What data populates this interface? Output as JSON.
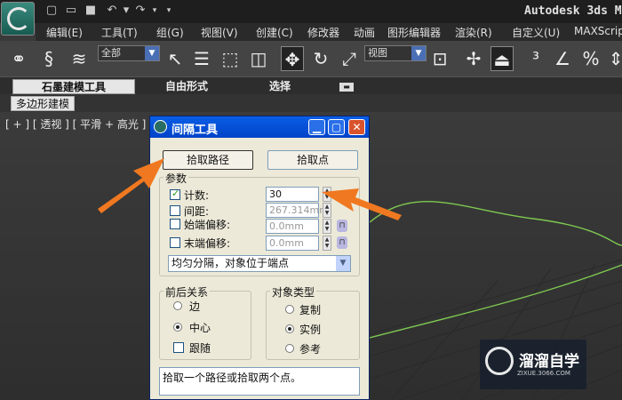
{
  "app": {
    "title": "Autodesk 3ds M"
  },
  "menu": [
    "编辑(E)",
    "工具(T)",
    "组(G)",
    "视图(V)",
    "创建(C)",
    "修改器",
    "动画",
    "图形编辑器",
    "渲染(R)",
    "自定义(U)",
    "MAXScript"
  ],
  "toolbar": {
    "selection_filter": "全部",
    "ref_coord": "视图"
  },
  "ribbon": {
    "tabs": [
      "石墨建模工具",
      "自由形式",
      "选择"
    ],
    "subtab": "多边形建模"
  },
  "viewport": {
    "label": "[ + ] [ 透视 ] [ 平滑 + 高光 ]"
  },
  "dialog": {
    "title": "间隔工具",
    "pick_path_button": "拾取路径",
    "pick_points_button": "拾取点",
    "params_group": "参数",
    "count_label": "计数:",
    "count_value": "30",
    "spacing_label": "间距:",
    "spacing_value": "267.314mm",
    "start_offset_label": "始端偏移:",
    "start_offset_value": "0.0mm",
    "end_offset_label": "末端偏移:",
    "end_offset_value": "0.0mm",
    "distribution_option": "均匀分隔，对象位于端点",
    "context_group": "前后关系",
    "context_options": [
      "边",
      "中心",
      "跟随"
    ],
    "object_type_group": "对象类型",
    "object_type_options": [
      "复制",
      "实例",
      "参考"
    ],
    "status_text": "拾取一个路径或拾取两个点。"
  },
  "watermark": {
    "title": "溜溜自学",
    "sub": "ZIXUE.3066.COM"
  },
  "colors": {
    "arrow": "#f07820",
    "spline": "#7ec850",
    "dialog_title": "#0a5ee6"
  }
}
